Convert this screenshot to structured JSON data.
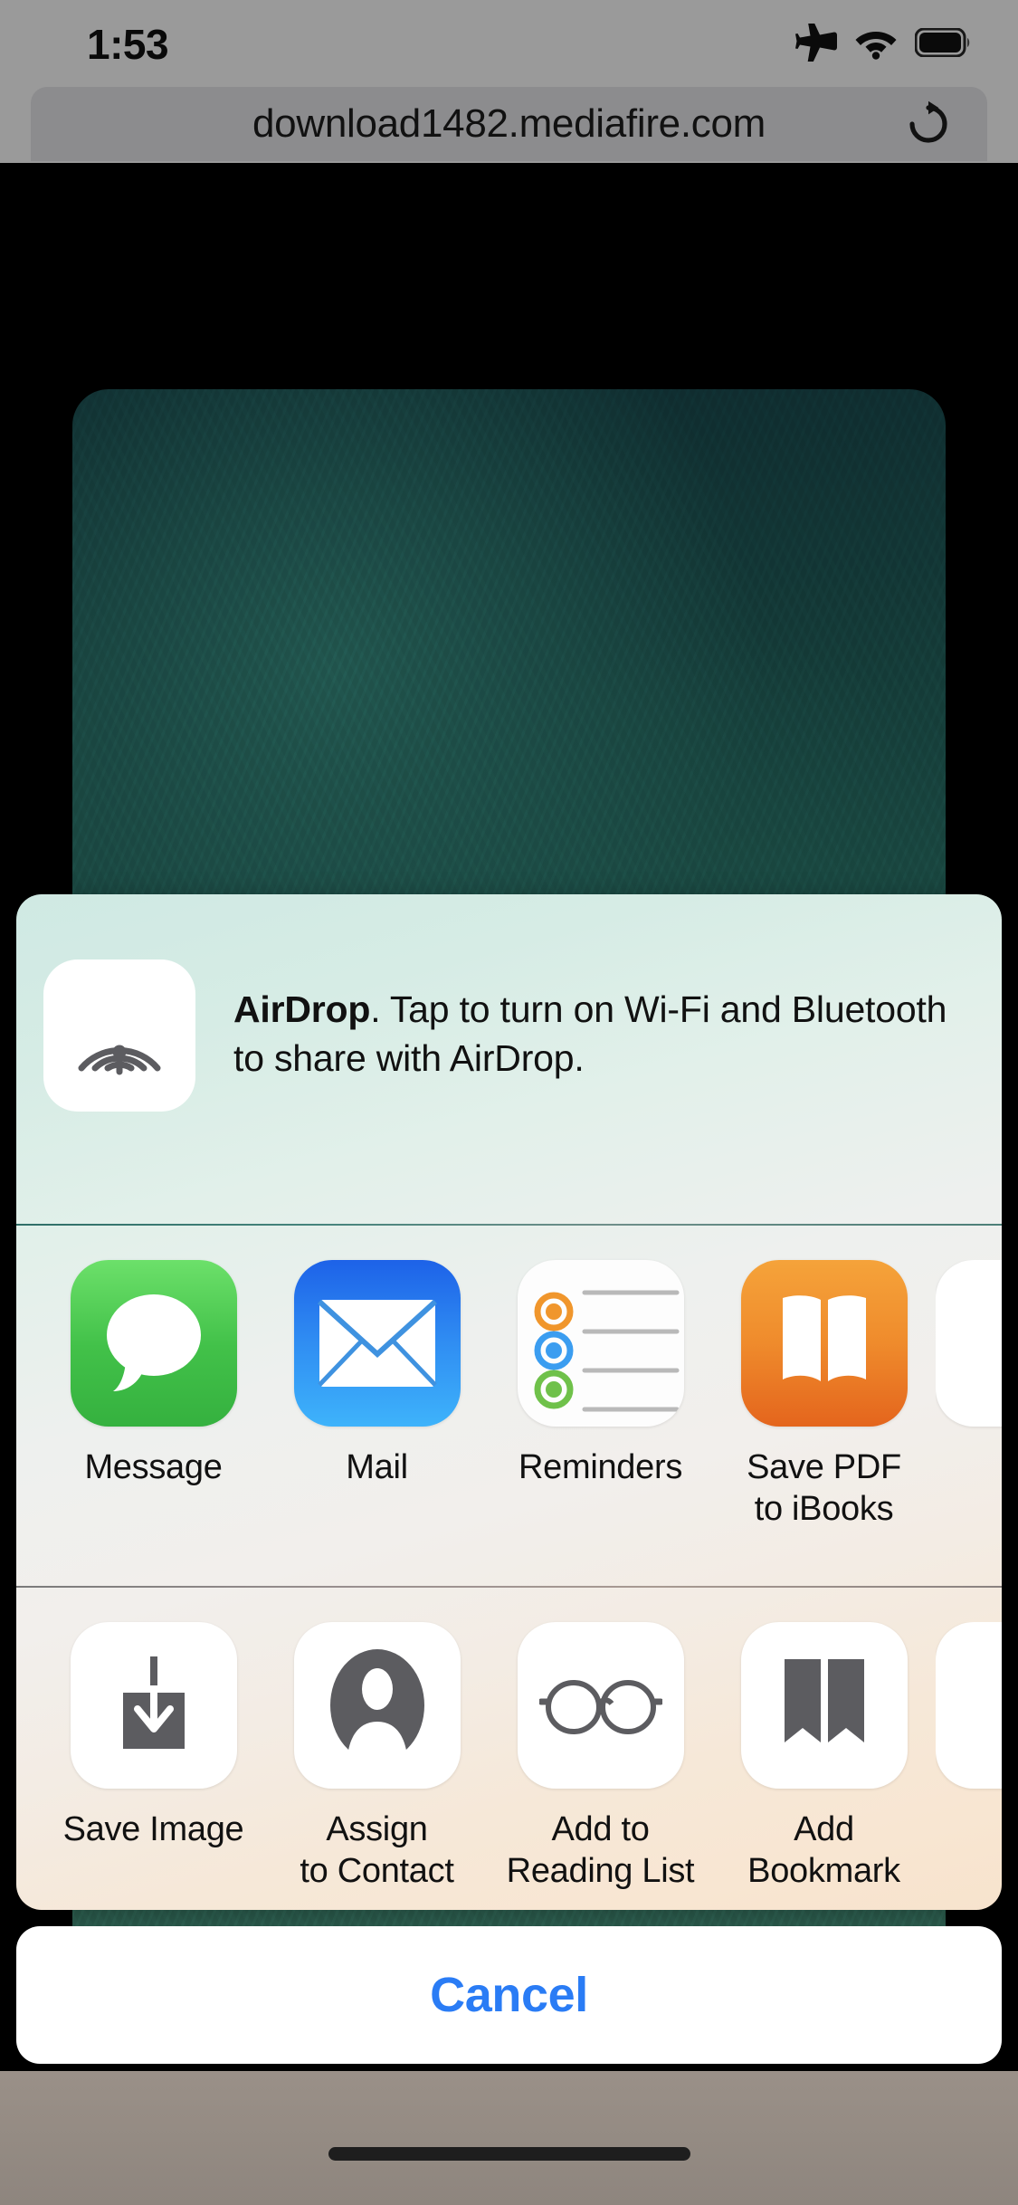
{
  "status_bar": {
    "time": "1:53",
    "icons": [
      "airplane-mode-icon",
      "wifi-icon",
      "battery-icon"
    ]
  },
  "browser": {
    "url": "download1482.mediafire.com",
    "reload_icon": "reload-icon"
  },
  "share_sheet": {
    "airdrop": {
      "icon": "airdrop-icon",
      "title": "AirDrop",
      "title_suffix": ".",
      "description": " Tap to turn on Wi-Fi and Bluetooth to share with AirDrop.",
      "full_text": "AirDrop. Tap to turn on Wi-Fi and Bluetooth to share with AirDrop."
    },
    "apps": [
      {
        "label": "Message",
        "icon": "message-app-icon"
      },
      {
        "label": "Mail",
        "icon": "mail-app-icon"
      },
      {
        "label": "Reminders",
        "icon": "reminders-app-icon"
      },
      {
        "label": "Save PDF\nto iBooks",
        "icon": "ibooks-app-icon"
      },
      {
        "label": "",
        "icon": "more-apps-icon"
      }
    ],
    "actions": [
      {
        "label": "Save Image",
        "icon": "save-image-icon"
      },
      {
        "label": "Assign\nto Contact",
        "icon": "contact-person-icon"
      },
      {
        "label": "Add to\nReading List",
        "icon": "glasses-icon"
      },
      {
        "label": "Add\nBookmark",
        "icon": "open-book-icon"
      },
      {
        "label": "",
        "icon": "more-actions-icon"
      }
    ],
    "cancel_label": "Cancel"
  },
  "colors": {
    "cancel_blue": "#2a7cf5",
    "sheet_tint_top": "#cfe9e3",
    "sheet_tint_bottom": "#f7e3cd",
    "chrome_gray": "#9a9a9a",
    "url_bar_gray": "#8c8c8e"
  }
}
